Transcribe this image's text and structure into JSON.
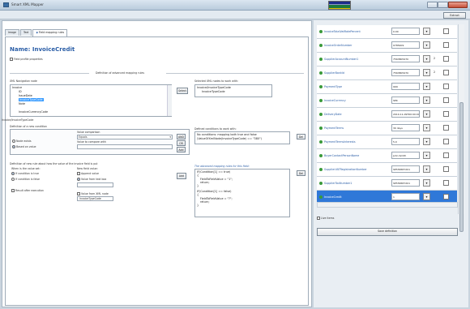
{
  "window": {
    "title": "Smart XML Mapper"
  },
  "toolbar": {
    "extract_label": "Extract"
  },
  "tabs": [
    {
      "label": "Image"
    },
    {
      "label": "Text"
    },
    {
      "label": "Field mapping rules"
    }
  ],
  "header": {
    "title": "Name: InvoiceCredit",
    "profile_label": "Field profile properties"
  },
  "definition": {
    "section_title": "Definition of advanced mapping rules",
    "xml_nav_label": "XML Navigation node",
    "tree": [
      "Invoice",
      "ID",
      "IssueDate",
      "InvoiceTypeCode",
      "Note",
      "InvoiceCurrencyCode"
    ],
    "select_label": "Select",
    "selected_label": "Selected XML nodes to work with:",
    "selected_values": [
      "Invoice/InvoiceTypeCode",
      "InvoiceTypeCode"
    ],
    "path_value": "Invoice/InvoiceTypeCode"
  },
  "condition": {
    "title": "Definition of a new condition",
    "value_comparison_label": "Value comparison",
    "comparison_value": "Equals",
    "compare_with_label": "Value to compare with",
    "exists_label": "Node exists",
    "based_on_value_label": "Based on value",
    "add_label": "Add",
    "del_label": "Del",
    "defined_label": "Defined conditions to work with:",
    "defined_values": [
      "No conditions: mapping both true and false",
      "(ValueOfXmlNode(InvoiceTypeCode) == \"380\")"
    ],
    "and_label": "AND",
    "or_label": "OR"
  },
  "newvalue": {
    "title": "Definition of new rule about how the value of the invoice field is put",
    "when_label": "When is the value set:",
    "if_true": "If condition is true",
    "if_false": "If condition is false",
    "new_field_label": "New field value:",
    "append_label": "Append value",
    "value_from_text_label": "Value from text box",
    "value_from_xml_label": "Value from XML node",
    "xml_node_value": "InvoiceTypeCode",
    "result_after_label": "Result after execution",
    "add_label": "Add",
    "del_label": "Del"
  },
  "advanced": {
    "title": "The advanced mapping rules for this field:",
    "lines": [
      "IF(Condition[1] == true)",
      "{",
      "  FieldToFieldValue = \"1\";",
      "  return;",
      "}",
      "IF(Condition[1] == false)",
      "{",
      "  FieldToFieldValue = \"?\";",
      "  return;",
      "}"
    ]
  },
  "properties": {
    "rows": [
      {
        "name": "InvoiceTotalVatRatePercent",
        "value": "0.00",
        "num": ""
      },
      {
        "name": "InvoiceOrderNumber",
        "value": "0785409",
        "num": ""
      },
      {
        "name": "SupplierAccountNumber1",
        "value": "7563805470",
        "num": "2"
      },
      {
        "name": "SupplierBankId",
        "value": "7563805470",
        "num": "2"
      },
      {
        "name": "PaymentType",
        "value": "999",
        "num": ""
      },
      {
        "name": "InvoiceCurrency",
        "value": "SEK",
        "num": ""
      },
      {
        "name": "DeliveryDate",
        "value": "2010-11-09T00:00:00",
        "num": ""
      },
      {
        "name": "PaymentTerms",
        "value": "30 days",
        "num": ""
      },
      {
        "name": "PaymentTermsInterests",
        "value": "5.0",
        "num": ""
      },
      {
        "name": "BuyerContactPersonName",
        "value": "John Smith",
        "num": ""
      },
      {
        "name": "SupplierVATRegistrationNumber",
        "value": "SE556587201",
        "num": ""
      },
      {
        "name": "SupplierTaxNumber1",
        "value": "SE556587201",
        "num": ""
      },
      {
        "name": "InvoiceCredit",
        "value": "1",
        "num": ""
      }
    ],
    "live_items_label": "Live items",
    "save_label": "Save definition"
  },
  "colors": {
    "accent": "#2b5ea7",
    "selection": "#2f78d8"
  }
}
